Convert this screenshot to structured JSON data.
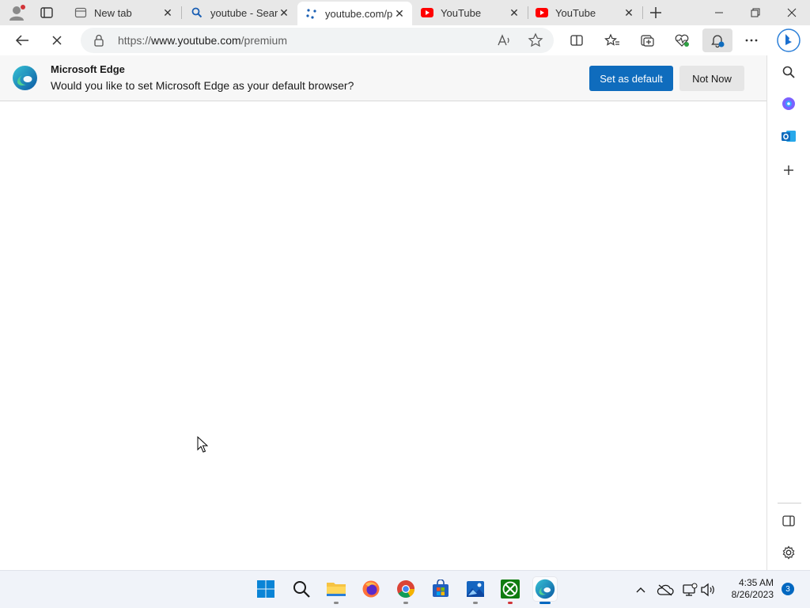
{
  "tabs": [
    {
      "title": "New tab",
      "favicon": "newtab-icon"
    },
    {
      "title": "youtube - Search",
      "favicon": "search-icon"
    },
    {
      "title": "youtube.com/premium",
      "favicon": "loading-icon"
    },
    {
      "title": "YouTube",
      "favicon": "youtube-icon"
    },
    {
      "title": "YouTube",
      "favicon": "youtube-icon"
    }
  ],
  "address": {
    "scheme": "https://",
    "host": "www.youtube.com",
    "path": "/premium"
  },
  "infobar": {
    "title": "Microsoft Edge",
    "message": "Would you like to set Microsoft Edge as your default browser?",
    "primary_label": "Set as default",
    "secondary_label": "Not Now"
  },
  "clock": {
    "time": "4:35 AM",
    "date": "8/26/2023"
  },
  "notifications_count": "3",
  "colors": {
    "accent": "#0f6cbd",
    "youtube_red": "#ff0000",
    "taskbar": "#f0f3f9"
  }
}
